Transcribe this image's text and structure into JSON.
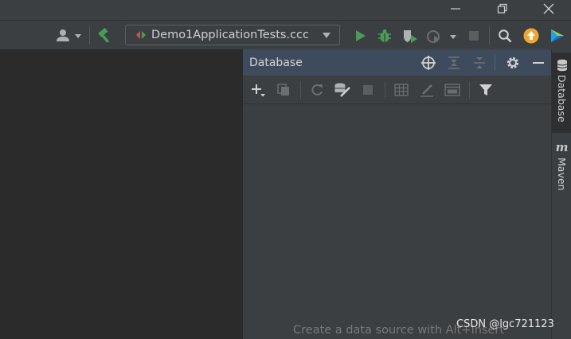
{
  "titlebar": {
    "minimize_icon": "minimize-icon",
    "restore_icon": "restore-icon",
    "close_icon": "close-icon"
  },
  "toolbar": {
    "run_config_label": "Demo1ApplicationTests.ccc",
    "icons": [
      "user-icon",
      "build-hammer-icon",
      "run-icon",
      "debug-icon",
      "coverage-icon",
      "profile-icon",
      "stop-icon",
      "search-icon",
      "update-icon",
      "toolbox-icon"
    ]
  },
  "database_panel": {
    "title": "Database",
    "empty_text": "Create a data source with Alt+Insert"
  },
  "right_tabs": [
    {
      "label": "Database",
      "active": true
    },
    {
      "label": "Maven",
      "active": false
    }
  ],
  "watermark": "CSDN @lgc721123",
  "colors": {
    "accent_green": "#499c54",
    "update_orange": "#f0a732",
    "header_blue": "#3d4b5c"
  }
}
